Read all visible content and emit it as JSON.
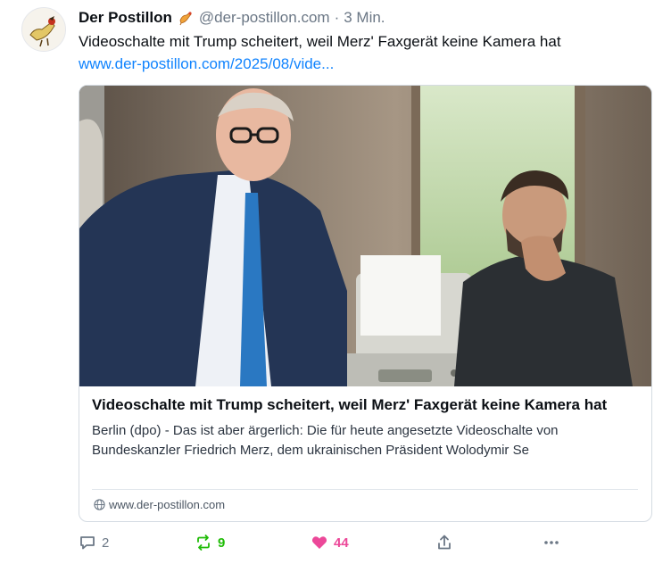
{
  "post": {
    "author_name": "Der Postillon",
    "author_emoji": "horn-emoji",
    "handle": "@der-postillon.com",
    "separator": "·",
    "time": "3 Min.",
    "text": "Videoschalte mit Trump scheitert, weil Merz' Faxgerät keine Kamera hat",
    "link": "www.der-postillon.com/2025/08/vide..."
  },
  "card": {
    "title": "Videoschalte mit Trump scheitert, weil Merz' Faxgerät keine Kamera hat",
    "description": "Berlin (dpo) - Das ist aber ärgerlich: Die für heute angesetzte Videoschalte von Bundeskanzler Friedrich Merz, dem ukrainischen Präsident Wolodymir Se",
    "domain": "www.der-postillon.com"
  },
  "actions": {
    "reply_count": "2",
    "repost_count": "9",
    "like_count": "44"
  },
  "colors": {
    "link": "#1083fe",
    "repost": "#20bc07",
    "like": "#ec4899",
    "muted": "#6b7785"
  }
}
